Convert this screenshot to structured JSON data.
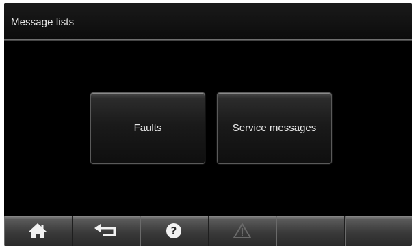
{
  "header": {
    "title": "Message lists"
  },
  "menu": {
    "buttons": [
      {
        "label": "Faults"
      },
      {
        "label": "Service messages"
      }
    ]
  },
  "navbar": {
    "items": [
      {
        "icon": "home-icon",
        "enabled": true
      },
      {
        "icon": "back-arrow-icon",
        "enabled": true
      },
      {
        "icon": "help-icon",
        "enabled": true
      },
      {
        "icon": "warning-icon",
        "enabled": false
      },
      {
        "icon": "empty",
        "enabled": false
      },
      {
        "icon": "empty",
        "enabled": false
      }
    ]
  },
  "colors": {
    "background": "#000000",
    "text": "#e6e6e6",
    "navbar": "#3a3a3a",
    "icon_active": "#f2f2f2",
    "icon_disabled": "#5a5a5a"
  }
}
